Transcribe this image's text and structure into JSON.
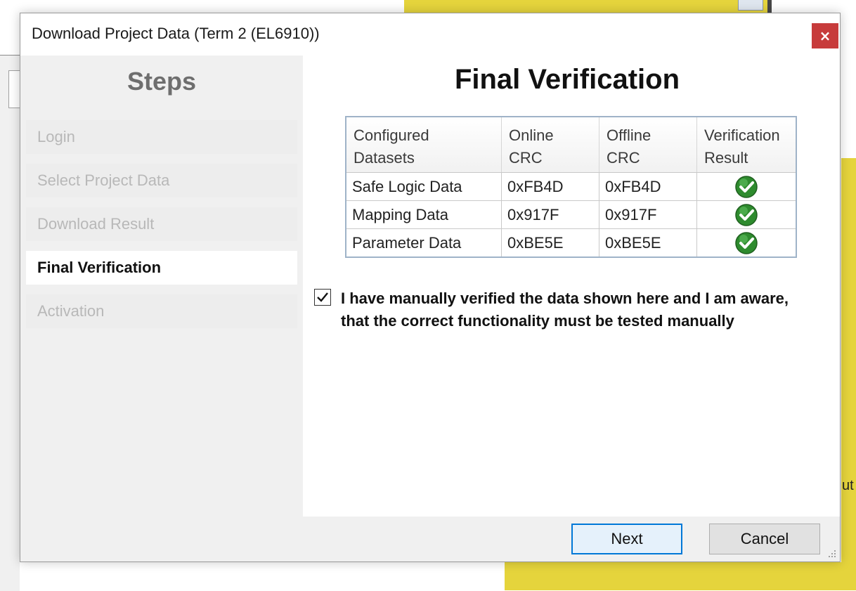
{
  "dialog": {
    "title": "Download Project Data (Term 2 (EL6910))",
    "close_label": "×"
  },
  "steps": {
    "heading": "Steps",
    "items": [
      {
        "label": "Login",
        "state": "inactive"
      },
      {
        "label": "Select Project Data",
        "state": "inactive"
      },
      {
        "label": "Download Result",
        "state": "inactive"
      },
      {
        "label": "Final Verification",
        "state": "active"
      },
      {
        "label": "Activation",
        "state": "inactive"
      }
    ]
  },
  "main": {
    "heading": "Final Verification",
    "table": {
      "headers": {
        "configured_l1": "Configured",
        "configured_l2": "Datasets",
        "online_l1": "Online",
        "online_l2": "CRC",
        "offline_l1": "Offline",
        "offline_l2": "CRC",
        "result_l1": "Verification",
        "result_l2": "Result"
      },
      "rows": [
        {
          "dataset": "Safe Logic Data",
          "online_crc": "0xFB4D",
          "offline_crc": "0xFB4D",
          "result_icon": "check-circle-icon"
        },
        {
          "dataset": "Mapping Data",
          "online_crc": "0x917F",
          "offline_crc": "0x917F",
          "result_icon": "check-circle-icon"
        },
        {
          "dataset": "Parameter Data",
          "online_crc": "0xBE5E",
          "offline_crc": "0xBE5E",
          "result_icon": "check-circle-icon"
        }
      ]
    },
    "confirmation": {
      "checked": true,
      "line1": "I have manually verified the data shown here and I am aware,",
      "line2": "that the correct functionality must be tested manually"
    }
  },
  "footer": {
    "next_label": "Next",
    "cancel_label": "Cancel"
  },
  "background": {
    "partial_text": "ut"
  },
  "colors": {
    "close_button": "#c73b3b",
    "check_green": "#2e8b2e",
    "next_border": "#0078d7",
    "background_yellow": "#e5d43c"
  }
}
